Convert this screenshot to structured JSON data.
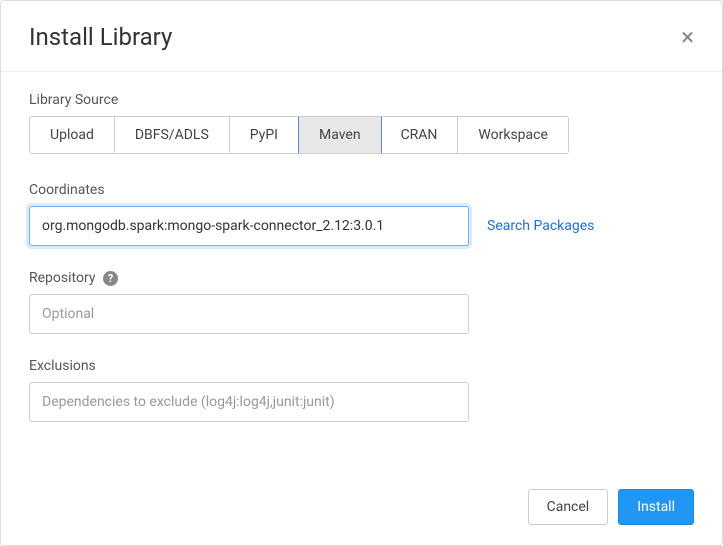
{
  "modal": {
    "title": "Install Library"
  },
  "librarySource": {
    "label": "Library Source",
    "tabs": [
      {
        "label": "Upload"
      },
      {
        "label": "DBFS/ADLS"
      },
      {
        "label": "PyPI"
      },
      {
        "label": "Maven"
      },
      {
        "label": "CRAN"
      },
      {
        "label": "Workspace"
      }
    ]
  },
  "coordinates": {
    "label": "Coordinates",
    "value": "org.mongodb.spark:mongo-spark-connector_2.12:3.0.1",
    "searchLink": "Search Packages"
  },
  "repository": {
    "label": "Repository",
    "placeholder": "Optional"
  },
  "exclusions": {
    "label": "Exclusions",
    "placeholder": "Dependencies to exclude (log4j:log4j,junit:junit)"
  },
  "footer": {
    "cancel": "Cancel",
    "install": "Install"
  }
}
